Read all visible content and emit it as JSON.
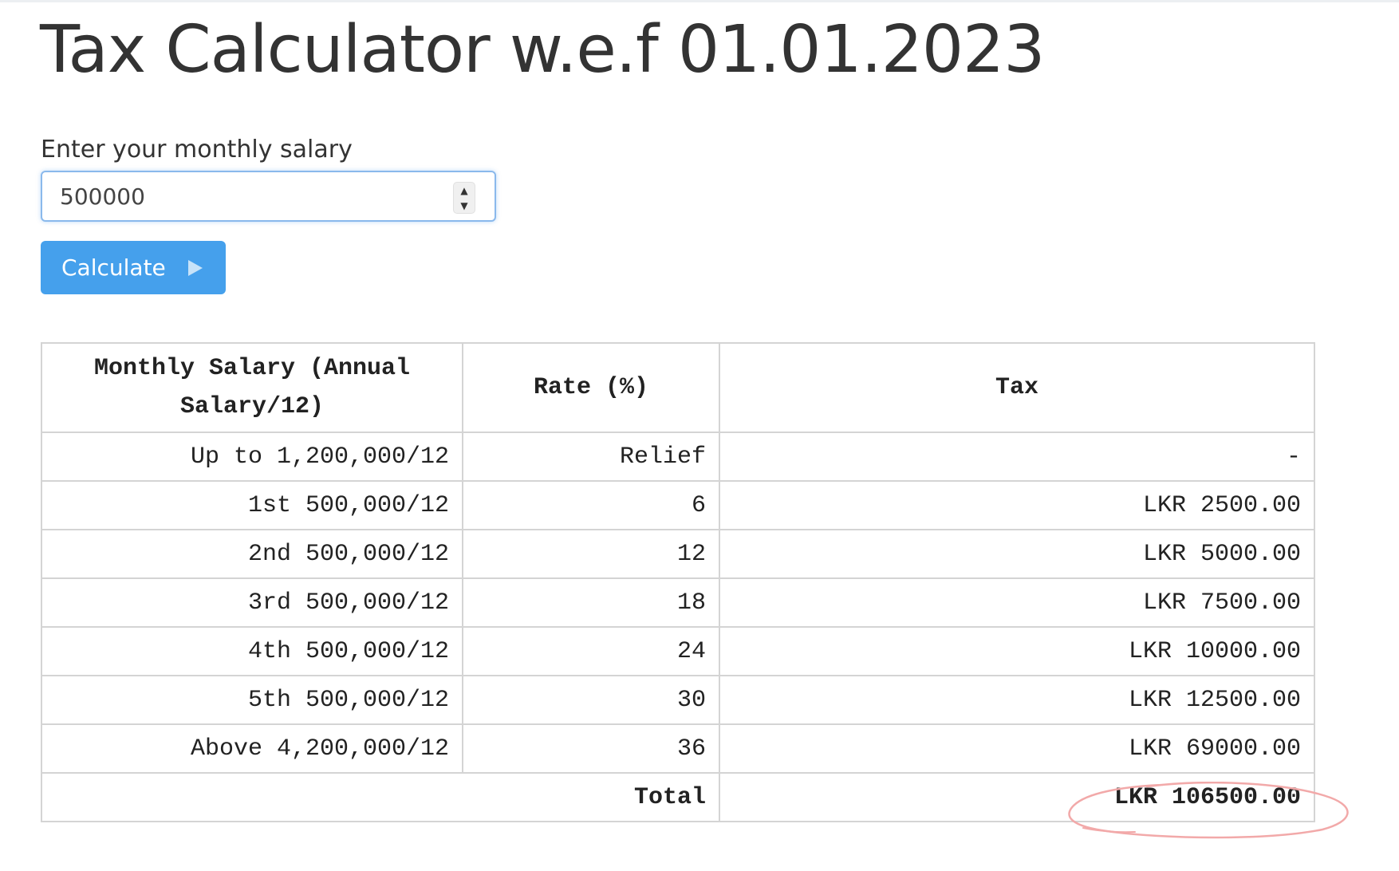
{
  "page": {
    "title": "Tax Calculator w.e.f 01.01.2023"
  },
  "form": {
    "salary_label": "Enter your monthly salary",
    "salary_value": "500000",
    "calculate_label": "Calculate"
  },
  "table": {
    "headers": [
      "Monthly Salary (Annual Salary/12)",
      "Rate (%)",
      "Tax"
    ],
    "rows": [
      {
        "slab": "Up to 1,200,000/12",
        "rate": "Relief",
        "tax": "-"
      },
      {
        "slab": "1st 500,000/12",
        "rate": "6",
        "tax": "LKR 2500.00"
      },
      {
        "slab": "2nd 500,000/12",
        "rate": "12",
        "tax": "LKR 5000.00"
      },
      {
        "slab": "3rd 500,000/12",
        "rate": "18",
        "tax": "LKR 7500.00"
      },
      {
        "slab": "4th 500,000/12",
        "rate": "24",
        "tax": "LKR 10000.00"
      },
      {
        "slab": "5th 500,000/12",
        "rate": "30",
        "tax": "LKR 12500.00"
      },
      {
        "slab": "Above 4,200,000/12",
        "rate": "36",
        "tax": "LKR 69000.00"
      }
    ],
    "total_label": "Total",
    "total_value": "LKR 106500.00"
  },
  "colors": {
    "button": "#45a0ec",
    "annotation": "#f2a9a9"
  }
}
